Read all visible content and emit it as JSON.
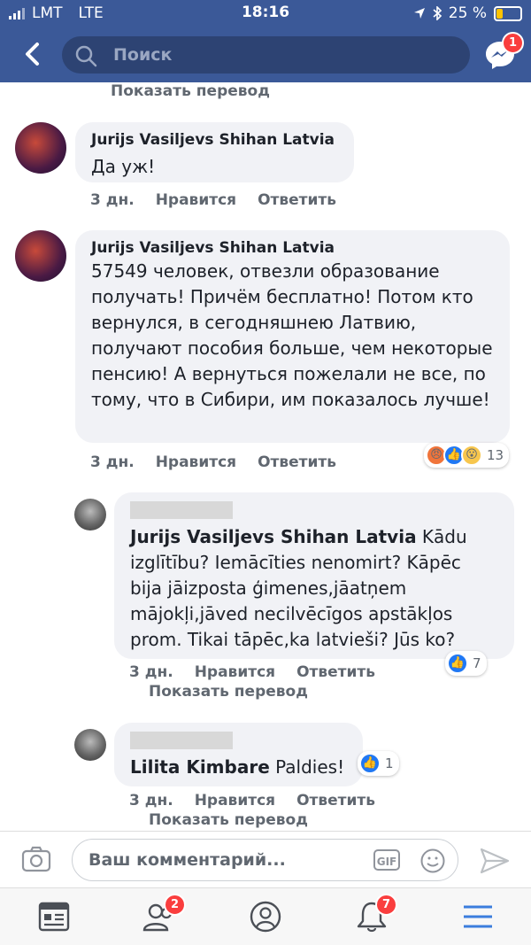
{
  "status": {
    "carrier": "LMT",
    "network": "LTE",
    "time": "18:16",
    "battery": "25 %"
  },
  "header": {
    "search_placeholder": "Поиск",
    "messenger_badge": "1"
  },
  "translate_label": "Показать перевод",
  "comments": [
    {
      "author": "Jurijs Vasiljevs Shihan Latvia",
      "text": "Да уж!",
      "time": "3 дн.",
      "like": "Нравится",
      "reply": "Ответить"
    },
    {
      "author": "Jurijs Vasiljevs Shihan Latvia",
      "text": "57549 человек, отвезли образование получать! Причём бесплатно! Потом кто вернулся, в сегодняшнею  Латвию, получают пособия больше, чем некоторые пенсию! А вернуться пожелали не все, по тому, что в Сибири, им показалось лучше!",
      "time": "3 дн.",
      "like": "Нравится",
      "reply": "Ответить",
      "reactions_count": "13"
    },
    {
      "mention": "Jurijs Vasiljevs Shihan Latvia",
      "text": " Kādu izglītību? Iemācīties nenomirt? Kāpēc bija jāizposta ģimenes,jāatņem mājokļi,jāved necilvēcīgos apstākļos prom. Tikai tāpēc,ka latvieši? Jūs ko?",
      "time": "3 дн.",
      "like": "Нравится",
      "reply": "Ответить",
      "reactions_count": "7"
    },
    {
      "mention": "Lilita Kimbare",
      "text": " Paldies!",
      "time": "3 дн.",
      "like": "Нравится",
      "reply": "Ответить",
      "reactions_count": "1"
    }
  ],
  "compose": {
    "placeholder": "Ваш комментарий...",
    "gif_label": "GIF"
  },
  "tabbar": {
    "friends_badge": "2",
    "notifications_badge": "7"
  },
  "colors": {
    "brand": "#3b5998",
    "badge": "#fa3e3e",
    "like": "#2078f4"
  }
}
